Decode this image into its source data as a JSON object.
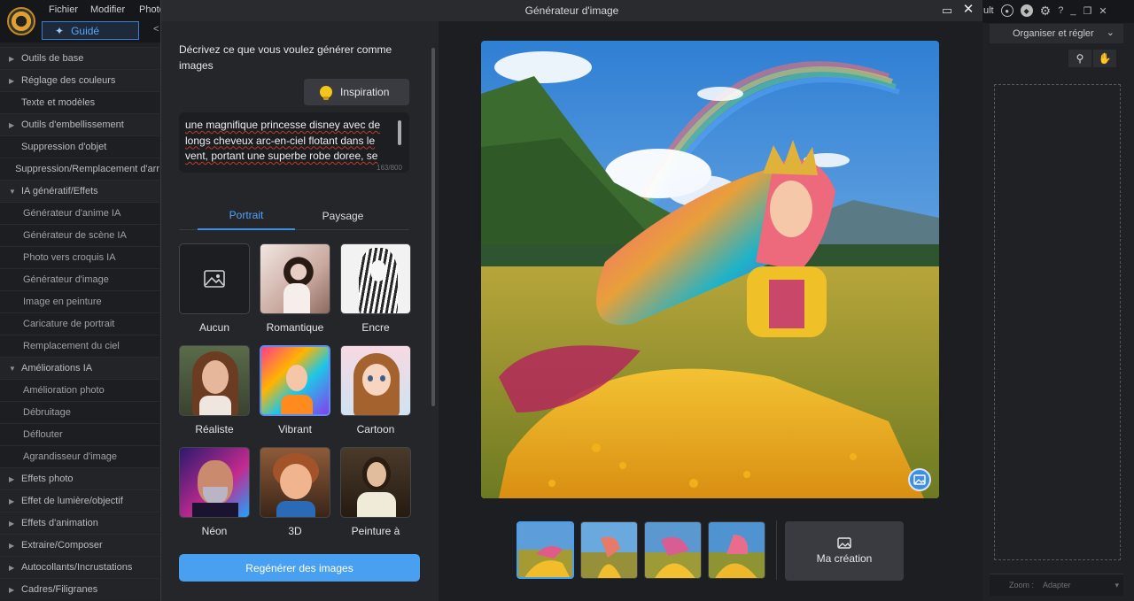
{
  "app": {
    "menu": [
      "Fichier",
      "Modifier",
      "Photo"
    ],
    "guide_label": "Guidé",
    "right_menu_partial": "ult",
    "organize_label": "Organiser et régler",
    "zoom_label": "Zoom :",
    "zoom_value": "Adapter"
  },
  "sidebar": {
    "items": [
      {
        "label": "Outils de base",
        "type": "cat",
        "arrow": "▶"
      },
      {
        "label": "Réglage des couleurs",
        "type": "cat",
        "arrow": "▶"
      },
      {
        "label": "Texte et modèles",
        "type": "plain"
      },
      {
        "label": "Outils d'embellissement",
        "type": "cat",
        "arrow": "▶"
      },
      {
        "label": "Suppression d'objet",
        "type": "plain"
      },
      {
        "label": "Suppression/Remplacement d'arr",
        "type": "plain"
      },
      {
        "label": "IA génératif/Effets",
        "type": "cat",
        "arrow": "▼"
      },
      {
        "label": "Générateur d'anime IA",
        "type": "sub"
      },
      {
        "label": "Générateur de scène IA",
        "type": "sub"
      },
      {
        "label": "Photo vers croquis IA",
        "type": "sub"
      },
      {
        "label": "Générateur d'image",
        "type": "sub"
      },
      {
        "label": "Image en peinture",
        "type": "sub"
      },
      {
        "label": "Caricature de portrait",
        "type": "sub"
      },
      {
        "label": "Remplacement du ciel",
        "type": "sub"
      },
      {
        "label": "Améliorations IA",
        "type": "cat",
        "arrow": "▼"
      },
      {
        "label": "Amélioration photo",
        "type": "sub"
      },
      {
        "label": "Débruitage",
        "type": "sub"
      },
      {
        "label": "Déflouter",
        "type": "sub"
      },
      {
        "label": "Agrandisseur d'image",
        "type": "sub"
      },
      {
        "label": "Effets photo",
        "type": "cat",
        "arrow": "▶"
      },
      {
        "label": "Effet de lumière/objectif",
        "type": "cat",
        "arrow": "▶"
      },
      {
        "label": "Effets d'animation",
        "type": "cat",
        "arrow": "▶"
      },
      {
        "label": "Extraire/Composer",
        "type": "cat",
        "arrow": "▶"
      },
      {
        "label": "Autocollants/Incrustations",
        "type": "cat",
        "arrow": "▶"
      },
      {
        "label": "Cadres/Filigranes",
        "type": "cat",
        "arrow": "▶"
      }
    ]
  },
  "modal": {
    "title": "Générateur d'image",
    "prompt_label": "Décrivez ce que vous voulez générer comme images",
    "inspiration_label": "Inspiration",
    "prompt_text": "une magnifique princesse disney avec de longs cheveux arc-en-ciel flotant dans le vent, portant une superbe robe doree, se",
    "char_count": "163/800",
    "tabs": [
      {
        "label": "Portrait",
        "active": true
      },
      {
        "label": "Paysage",
        "active": false
      }
    ],
    "styles": [
      {
        "label": "Aucun",
        "selected": false
      },
      {
        "label": "Romantique",
        "selected": false
      },
      {
        "label": "Encre",
        "selected": false
      },
      {
        "label": "Réaliste",
        "selected": false
      },
      {
        "label": "Vibrant",
        "selected": true
      },
      {
        "label": "Cartoon",
        "selected": false
      },
      {
        "label": "Néon",
        "selected": false
      },
      {
        "label": "3D",
        "selected": false
      },
      {
        "label": "Peinture à",
        "selected": false
      }
    ],
    "regenerate_label": "Regénérer des images",
    "ma_creation_label": "Ma création",
    "generated_count": 4,
    "selected_thumb": 1
  },
  "colors": {
    "accent": "#4aa0f0",
    "tab_active": "#4ea3ff",
    "modal_bg": "#26272b"
  }
}
